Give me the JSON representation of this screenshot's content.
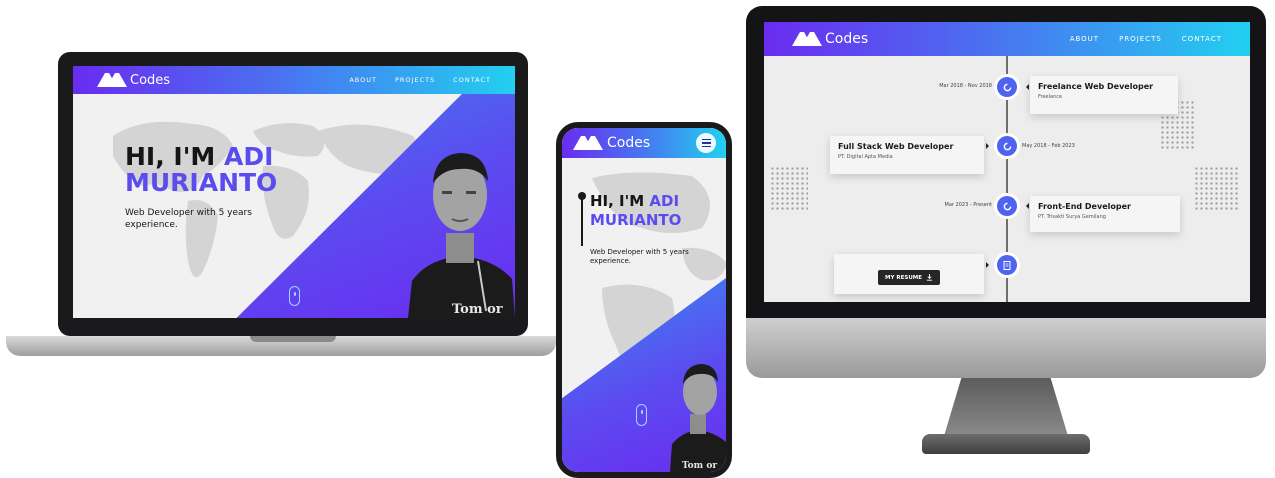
{
  "site": {
    "brand": "Codes",
    "nav": [
      "ABOUT",
      "PROJECTS",
      "CONTACT"
    ],
    "hero": {
      "greeting": "HI, I'M",
      "first_name": "ADI",
      "last_name": "MURIANTO",
      "subtitle": "Web Developer with 5 years experience."
    },
    "shirt_text": "Tom or"
  },
  "timeline": {
    "items": [
      {
        "date": "Mar 2018 - Nov 2018",
        "title": "Freelance Web Developer",
        "company": "Freelance",
        "icon": "briefcase-icon"
      },
      {
        "date": "May 2018 - Feb 2023",
        "title": "Full Stack Web Developer",
        "company": "PT. Digital Apta Media",
        "icon": "briefcase-icon"
      },
      {
        "date": "Mar 2023 - Present",
        "title": "Front-End Developer",
        "company": "PT. Trisakti Surya Gemilang",
        "icon": "briefcase-icon"
      }
    ],
    "resume_label": "MY RESUME",
    "resume_icon": "download-icon",
    "end_icon": "document-icon"
  },
  "colors": {
    "nav_gradient_start": "#6a2cf0",
    "nav_gradient_end": "#22d0f0",
    "accent": "#5b4cf0",
    "timeline_dot": "#4e63ef"
  }
}
